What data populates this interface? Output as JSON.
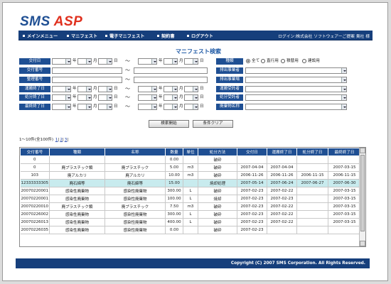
{
  "logo": {
    "part1": "SMS",
    "part2": "ASP"
  },
  "nav": {
    "items": [
      "メインメニュー",
      "マニフェスト",
      "電子マニフェスト",
      "契約書",
      "ログアウト"
    ],
    "user": "ログイン:株式会社 ソフトウェアーご提案 貴社 様"
  },
  "page": {
    "title": "マニフェスト検索"
  },
  "form": {
    "labels": [
      "交付日",
      "交付番号",
      "整理番号",
      "運搬終了日",
      "処分終了日",
      "最終終了日"
    ],
    "date_units": {
      "year": "年",
      "month": "月",
      "day": "日"
    },
    "tilde": "～",
    "kind": {
      "label": "種類",
      "options": [
        "全て",
        "直行用",
        "積替用",
        "建設用"
      ],
      "selected": "全て"
    },
    "right_labels": [
      "排出事業者",
      "排出事業場",
      "運搬受託者",
      "処分受託者",
      "廃棄物名称"
    ],
    "search_button": "検索開始",
    "clear_button": "条件クリア"
  },
  "results": {
    "summary": "1～10件(全100件)",
    "pages": [
      "1",
      "2",
      "3"
    ]
  },
  "table": {
    "headers": [
      "交付番号",
      "種類",
      "名称",
      "数量",
      "単位",
      "処分方法",
      "交付日",
      "運搬終了日",
      "処分終了日",
      "最終終了日"
    ],
    "rows": [
      [
        "0",
        "",
        "",
        "0.00",
        "",
        "破砕",
        "",
        "",
        "",
        ""
      ],
      [
        "0",
        "廃プラスチック類",
        "廃プラスチック",
        "5.00",
        "m3",
        "破砕",
        "2007-04-04",
        "2007-04-04",
        "",
        "2007-03-15"
      ],
      [
        "103",
        "廃アルカリ",
        "廃アルカリ",
        "10.00",
        "m3",
        "破砕",
        "2006-11-26",
        "2006-11-26",
        "2006-11-15",
        "2006-11-15"
      ],
      [
        "12333333305",
        "廃石綿等",
        "廃石綿等",
        "15.00",
        "",
        "焼却処理",
        "2007-05-14",
        "2007-06-24",
        "2007-06-27",
        "2007-06-30"
      ],
      [
        "20070220001",
        "感染性廃棄物",
        "感染性廃棄物",
        "300.00",
        "L",
        "破砕",
        "2007-02-23",
        "2007-02-22",
        "",
        "2007-03-15"
      ],
      [
        "20070220001",
        "感染性廃棄物",
        "感染性廃棄物",
        "100.00",
        "L",
        "焼却",
        "2007-02-23",
        "2007-02-23",
        "",
        "2007-03-15"
      ],
      [
        "20070220010",
        "廃プラスチック類",
        "廃プラスチック",
        "7.50",
        "m3",
        "破砕",
        "2007-02-23",
        "2007-02-22",
        "",
        "2007-03-15"
      ],
      [
        "20070226002",
        "感染性廃棄物",
        "感染性廃棄物",
        "300.00",
        "L",
        "破砕",
        "2007-02-23",
        "2007-02-22",
        "",
        "2007-03-15"
      ],
      [
        "20070226013",
        "感染性廃棄物",
        "感染性廃棄物",
        "400.00",
        "L",
        "破砕",
        "2007-02-23",
        "2007-02-22",
        "",
        "2007-03-15"
      ],
      [
        "20070226035",
        "感染性廃棄物",
        "感染性廃棄物",
        "0.00",
        "",
        "破砕",
        "2007-02-23",
        "",
        "",
        ""
      ]
    ],
    "highlight_row": 3
  },
  "footer": {
    "copyright": "Copyright (C) 2007 SMS Corporation. All Rights Reserved."
  },
  "colors": {
    "brand": "#163f7c",
    "accent": "#e0301e",
    "highlight": "#c8ebee"
  }
}
